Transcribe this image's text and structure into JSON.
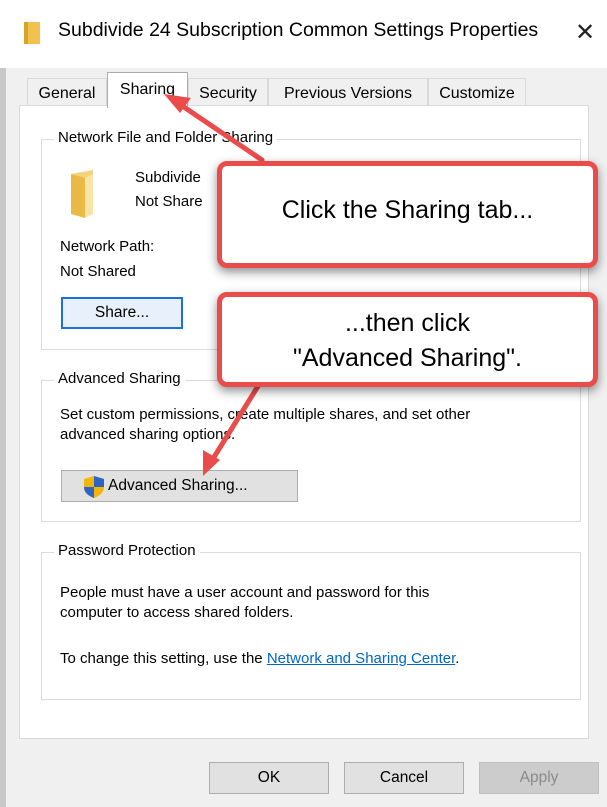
{
  "window": {
    "title": "Subdivide 24 Subscription Common Settings Properties",
    "icon": "folder-icon",
    "close_glyph": "✕"
  },
  "tabs": [
    {
      "label": "General",
      "active": false
    },
    {
      "label": "Sharing",
      "active": true
    },
    {
      "label": "Security",
      "active": false
    },
    {
      "label": "Previous Versions",
      "active": false
    },
    {
      "label": "Customize",
      "active": false
    }
  ],
  "network_sharing": {
    "group_title": "Network File and Folder Sharing",
    "folder_name": "Subdivide",
    "folder_status": "Not Share",
    "path_label": "Network Path:",
    "path_value": "Not Shared",
    "share_button": "Share..."
  },
  "advanced_sharing": {
    "group_title": "Advanced Sharing",
    "description_line1": "Set custom permissions, create multiple shares, and set other",
    "description_line2": "advanced sharing options.",
    "button": "Advanced Sharing...",
    "button_icon": "uac-shield-icon"
  },
  "password_protection": {
    "group_title": "Password Protection",
    "line1": "People must have a user account and password for this",
    "line2": "computer to access shared folders.",
    "line3_prefix": "To change this setting, use the ",
    "link_text": "Network and Sharing Center",
    "line3_suffix": "."
  },
  "footer": {
    "ok": "OK",
    "cancel": "Cancel",
    "apply": "Apply"
  },
  "annotations": {
    "callout1": "Click the Sharing tab...",
    "callout2_line1": "...then click",
    "callout2_line2": "\"Advanced Sharing\".",
    "color": "#ea4b4b"
  }
}
